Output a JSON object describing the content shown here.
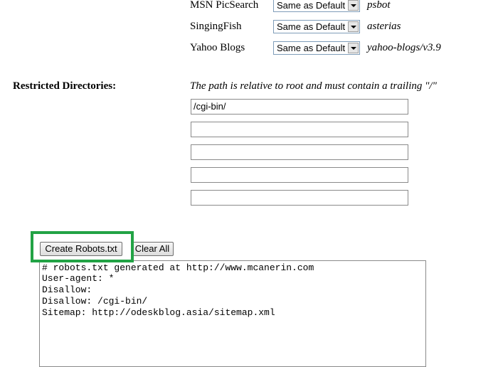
{
  "bots": [
    {
      "name": "MSN PicSearch",
      "select_value": "Same as Default",
      "id": "psbot"
    },
    {
      "name": "SingingFish",
      "select_value": "Same as Default",
      "id": "asterias"
    },
    {
      "name": "Yahoo Blogs",
      "select_value": "Same as Default",
      "id": "yahoo-blogs/v3.9"
    }
  ],
  "restricted": {
    "label": "Restricted Directories:",
    "hint": "The path is relative to root and must contain a trailing \"/\"",
    "inputs": [
      "/cgi-bin/",
      "",
      "",
      "",
      ""
    ]
  },
  "buttons": {
    "create": "Create Robots.txt",
    "clear": "Clear All"
  },
  "output": {
    "lines": [
      "# robots.txt generated at http://www.mcanerin.com",
      "User-agent: *",
      "Disallow:",
      "Disallow: /cgi-bin/",
      "Sitemap: http://odeskblog.asia/sitemap.xml"
    ]
  },
  "colors": {
    "highlight": "#22a345"
  }
}
